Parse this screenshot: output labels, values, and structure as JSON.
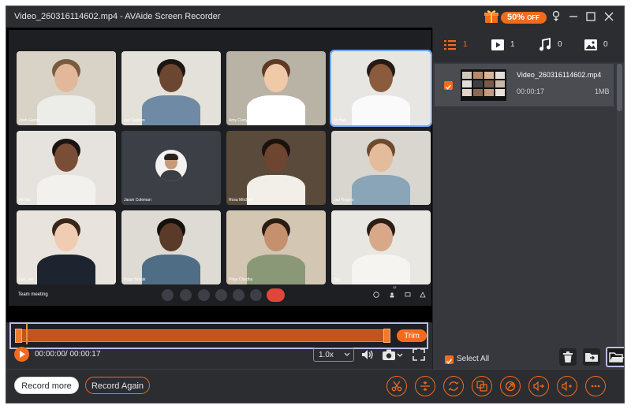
{
  "window": {
    "title": "Video_260316114602.mp4 - AVAide Screen Recorder"
  },
  "promo": {
    "discount": "50%",
    "suffix": "OFF"
  },
  "meeting": {
    "label": "Team meeting",
    "participant_count": "12",
    "tiles": [
      {
        "name": "Josh Garner",
        "bg": "#d8d2c7",
        "skin": "#e2b89a",
        "shirt": "#ecece8",
        "hair": "#7a5a3e"
      },
      {
        "name": "Joe Carlson",
        "bg": "#e4e1da",
        "skin": "#6b4630",
        "shirt": "#6f8aa5",
        "hair": "#1d1512"
      },
      {
        "name": "Amy Curry",
        "bg": "#b9b3a5",
        "skin": "#f0c9a9",
        "shirt": "#ffffff",
        "hair": "#5e3a24"
      },
      {
        "name": "Jo Hall",
        "bg": "#e7e6e3",
        "skin": "#8b5b3e",
        "shirt": "#fafafa",
        "hair": "#261a14"
      },
      {
        "name": "Ali Nor",
        "bg": "#e6e3df",
        "skin": "#7a4e36",
        "shirt": "#f3f1ee",
        "hair": "#1a1410"
      },
      {
        "name": "Jason Coleman",
        "bg": "#3c3f45",
        "skin": "#c79a7a",
        "shirt": "#3b3e42",
        "hair": "#2b211b",
        "avatar": true
      },
      {
        "name": "Rosa Mitchell",
        "bg": "#5a4a3c",
        "skin": "#6e4530",
        "shirt": "#f2efe9",
        "hair": "#1b120d"
      },
      {
        "name": "Jad Rogers",
        "bg": "#d9d6d0",
        "skin": "#e4bc9c",
        "shirt": "#8aa4b8",
        "hair": "#6c4a30"
      },
      {
        "name": "Lori Lee",
        "bg": "#e8e4dd",
        "skin": "#f0cdb2",
        "shirt": "#1d2430",
        "hair": "#3a2519"
      },
      {
        "name": "Hugo Novak",
        "bg": "#dedbd5",
        "skin": "#5a3a28",
        "shirt": "#4f6e86",
        "hair": "#16100c"
      },
      {
        "name": "Priya Chadha",
        "bg": "#d3c7b4",
        "skin": "#c4906e",
        "shirt": "#8a9878",
        "hair": "#2a1b13"
      },
      {
        "name": "You",
        "bg": "#e9e7e2",
        "skin": "#d8a889",
        "shirt": "#f6f4f1",
        "hair": "#2c1d15"
      }
    ]
  },
  "trim": {
    "button_label": "Trim"
  },
  "playback": {
    "time": "00:00:00/ 00:00:17",
    "speed": "1.0x"
  },
  "tabs": [
    {
      "icon": "list-icon",
      "count": "1"
    },
    {
      "icon": "video-icon",
      "count": "1"
    },
    {
      "icon": "music-icon",
      "count": "0"
    },
    {
      "icon": "image-icon",
      "count": "0"
    }
  ],
  "file": {
    "name": "Video_260316114602.mp4",
    "duration": "00:00:17",
    "size": "1MB"
  },
  "panel": {
    "select_all": "Select All"
  },
  "bottom": {
    "record_more": "Record more",
    "record_again": "Record Again"
  },
  "colors": {
    "accent": "#f26b1d",
    "frame": "#b9bde6"
  }
}
